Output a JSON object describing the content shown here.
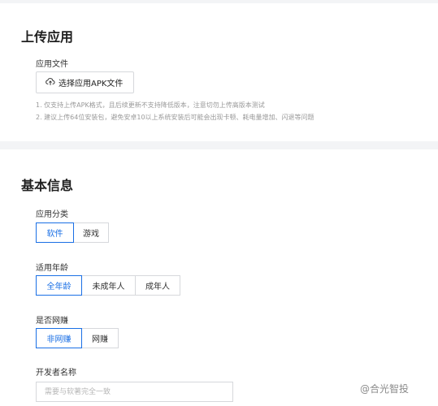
{
  "upload_section": {
    "title": "上传应用",
    "file_label": "应用文件",
    "upload_button": "选择应用APK文件",
    "hints": [
      "1. 仅支持上传APK格式，且后续更新不支持降低版本，注意切勿上传高版本测试",
      "2. 建议上传64位安装包，避免安卓10以上系统安装后可能会出现卡顿、耗电量增加、闪退等问题"
    ]
  },
  "basic_info": {
    "title": "基本信息",
    "category": {
      "label": "应用分类",
      "options": [
        "软件",
        "游戏"
      ],
      "selected": "软件"
    },
    "age": {
      "label": "适用年龄",
      "options": [
        "全年龄",
        "未成年人",
        "成年人"
      ],
      "selected": "全年龄"
    },
    "online_earning": {
      "label": "是否网赚",
      "options": [
        "非网赚",
        "网赚"
      ],
      "selected": "非网赚"
    },
    "developer": {
      "label": "开发者名称",
      "placeholder": "需要与软著完全一致",
      "value": ""
    }
  },
  "watermark": {
    "text": "@合光智投"
  },
  "colors": {
    "accent": "#1a6fe5",
    "border": "#d6d8dc",
    "page_bg": "#f3f4f6"
  },
  "icons": {
    "upload": "cloud-upload-icon"
  }
}
